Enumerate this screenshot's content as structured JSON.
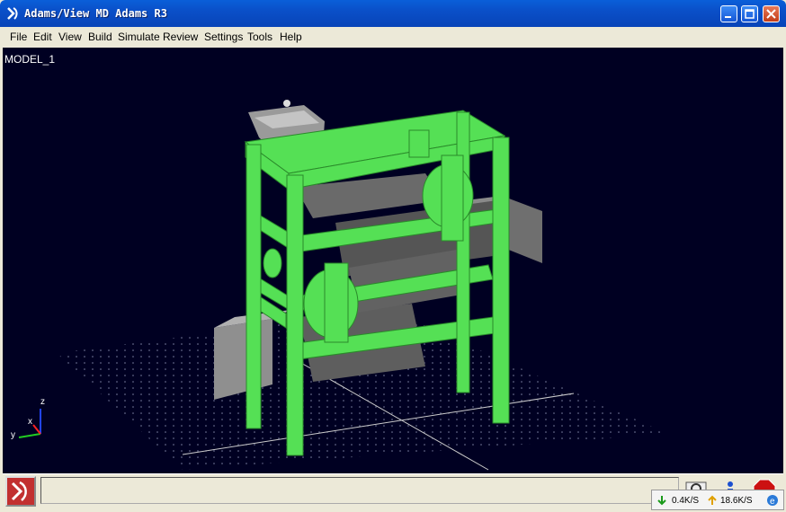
{
  "window": {
    "title": "Adams/View MD Adams R3"
  },
  "menu": {
    "items": [
      "File",
      "Edit",
      "View",
      "Build",
      "Simulate",
      "Review",
      "Settings",
      "Tools",
      "Help"
    ]
  },
  "viewport": {
    "model_name": "MODEL_1",
    "triad": {
      "z": "z",
      "x": "x",
      "y": "y"
    },
    "colors": {
      "background": "#000022",
      "frame": "#55e055",
      "parts": "#7a7a7a"
    }
  },
  "status": {
    "icons": [
      "adams-logo",
      "info-icon",
      "help-icon",
      "stop-icon"
    ]
  },
  "net_monitor": {
    "download": "0.4K/S",
    "upload": "18.6K/S"
  }
}
